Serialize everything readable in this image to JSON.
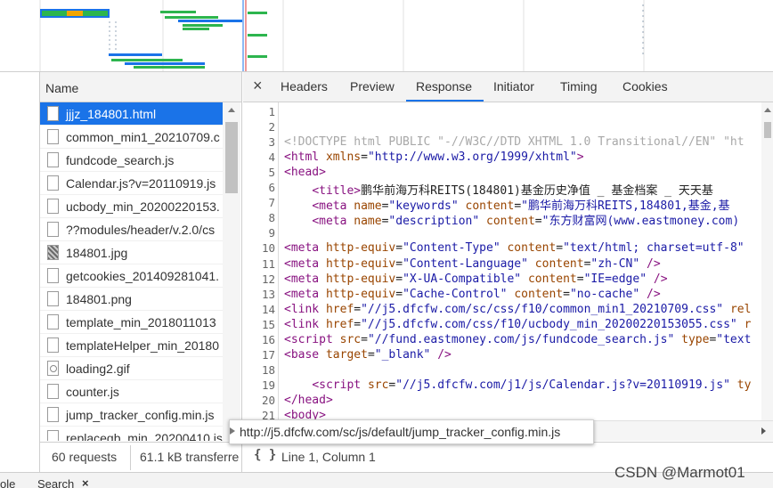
{
  "namecol": {
    "header": "Name"
  },
  "files": [
    {
      "name": "jjjz_184801.html",
      "type": "doc",
      "selected": true
    },
    {
      "name": "common_min1_20210709.c",
      "type": "doc"
    },
    {
      "name": "fundcode_search.js",
      "type": "doc"
    },
    {
      "name": "Calendar.js?v=20110919.js",
      "type": "doc"
    },
    {
      "name": "ucbody_min_20200220153.",
      "type": "doc"
    },
    {
      "name": "??modules/header/v.2.0/cs",
      "type": "doc"
    },
    {
      "name": "184801.jpg",
      "type": "img"
    },
    {
      "name": "getcookies_201409281041.",
      "type": "doc"
    },
    {
      "name": "184801.png",
      "type": "doc"
    },
    {
      "name": "template_min_2018011013",
      "type": "doc"
    },
    {
      "name": "templateHelper_min_20180",
      "type": "doc"
    },
    {
      "name": "loading2.gif",
      "type": "gif"
    },
    {
      "name": "counter.js",
      "type": "doc"
    },
    {
      "name": "jump_tracker_config.min.js",
      "type": "doc"
    },
    {
      "name": "replaceqb_min_20200410.js",
      "type": "doc"
    }
  ],
  "tabs": [
    "Headers",
    "Preview",
    "Response",
    "Initiator",
    "Timing",
    "Cookies"
  ],
  "active_tab": "Response",
  "close_label": "×",
  "code": [
    {
      "n": "1",
      "t": ""
    },
    {
      "n": "2",
      "t": ""
    },
    {
      "n": "3",
      "t": ""
    },
    {
      "n": "4",
      "t": ""
    },
    {
      "n": "5",
      "t": ""
    },
    {
      "n": "6",
      "t": ""
    },
    {
      "n": "7",
      "t": ""
    },
    {
      "n": "8",
      "t": ""
    },
    {
      "n": "9",
      "t": ""
    },
    {
      "n": "10",
      "t": ""
    },
    {
      "n": "11",
      "t": ""
    },
    {
      "n": "12",
      "t": ""
    },
    {
      "n": "13",
      "t": ""
    },
    {
      "n": "14",
      "t": ""
    },
    {
      "n": "15",
      "t": ""
    },
    {
      "n": "16",
      "t": ""
    },
    {
      "n": "17",
      "t": ""
    },
    {
      "n": "18",
      "t": ""
    },
    {
      "n": "19",
      "t": ""
    },
    {
      "n": "20",
      "t": ""
    },
    {
      "n": "21",
      "t": ""
    }
  ],
  "code_html": [
    "",
    "",
    "<span class=\"cm\">&lt;!DOCTYPE html PUBLIC \"-//W3C//DTD XHTML 1.0 Transitional//EN\" \"ht</span>",
    "<span class=\"tg\">&lt;html</span> <span class=\"at\">xmlns</span>=<span class=\"av\">\"http://www.w3.org/1999/xhtml\"</span><span class=\"tg\">&gt;</span>",
    "<span class=\"tg\">&lt;head&gt;</span>",
    "    <span class=\"tg\">&lt;title&gt;</span>鹏华前海万科REITS(184801)基金历史净值 _ 基金档案 _ 天天基",
    "    <span class=\"tg\">&lt;meta</span> <span class=\"at\">name</span>=<span class=\"av\">\"keywords\"</span> <span class=\"at\">content</span>=<span class=\"av\">\"鹏华前海万科REITS,184801,基金,基</span>",
    "    <span class=\"tg\">&lt;meta</span> <span class=\"at\">name</span>=<span class=\"av\">\"description\"</span> <span class=\"at\">content</span>=<span class=\"av\">\"东方财富网(www.eastmoney.com)</span>",
    "",
    "<span class=\"tg\">&lt;meta</span> <span class=\"at\">http-equiv</span>=<span class=\"av\">\"Content-Type\"</span> <span class=\"at\">content</span>=<span class=\"av\">\"text/html; charset=utf-8\"</span>",
    "<span class=\"tg\">&lt;meta</span> <span class=\"at\">http-equiv</span>=<span class=\"av\">\"Content-Language\"</span> <span class=\"at\">content</span>=<span class=\"av\">\"zh-CN\"</span> <span class=\"tg\">/&gt;</span>",
    "<span class=\"tg\">&lt;meta</span> <span class=\"at\">http-equiv</span>=<span class=\"av\">\"X-UA-Compatible\"</span> <span class=\"at\">content</span>=<span class=\"av\">\"IE=edge\"</span> <span class=\"tg\">/&gt;</span>",
    "<span class=\"tg\">&lt;meta</span> <span class=\"at\">http-equiv</span>=<span class=\"av\">\"Cache-Control\"</span> <span class=\"at\">content</span>=<span class=\"av\">\"no-cache\"</span> <span class=\"tg\">/&gt;</span>",
    "<span class=\"tg\">&lt;link</span> <span class=\"at\">href</span>=<span class=\"av\">\"//j5.dfcfw.com/sc/css/f10/common_min1_20210709.css\"</span> <span class=\"at\">rel</span>",
    "<span class=\"tg\">&lt;link</span> <span class=\"at\">href</span>=<span class=\"av\">\"//j5.dfcfw.com/css/f10/ucbody_min_20200220153055.css\"</span> <span class=\"at\">r</span>",
    "<span class=\"tg\">&lt;script</span> <span class=\"at\">src</span>=<span class=\"av\">\"//fund.eastmoney.com/js/fundcode_search.js\"</span> <span class=\"at\">type</span>=<span class=\"av\">\"text</span>",
    "<span class=\"tg\">&lt;base</span> <span class=\"at\">target</span>=<span class=\"av\">\"_blank\"</span> <span class=\"tg\">/&gt;</span>",
    "",
    "    <span class=\"tg\">&lt;script</span> <span class=\"at\">src</span>=<span class=\"av\">\"//j5.dfcfw.com/j1/js/Calendar.js?v=20110919.js\"</span> <span class=\"at\">ty</span>",
    "<span class=\"tg\">&lt;/head&gt;</span>",
    "<span class=\"tg\">&lt;body&gt;</span>"
  ],
  "status": {
    "requests": "60 requests",
    "transferred": "61.1 kB transferre",
    "pretty_print": "{ }",
    "cursor": "Line 1, Column 1"
  },
  "tooltip": "http://j5.dfcfw.com/sc/js/default/jump_tracker_config.min.js",
  "drawer": {
    "left_fragment": "ole",
    "search_label": "Search",
    "search_close": "×"
  },
  "watermark": "CSDN @Marmot01",
  "colors": {
    "selection": "#1a73e8",
    "tag": "#881280",
    "attr": "#994500",
    "value": "#1a1aa6",
    "comment": "#a8a8a8",
    "waterfall_green": "#2db54e",
    "waterfall_blue": "#1a73e8"
  }
}
